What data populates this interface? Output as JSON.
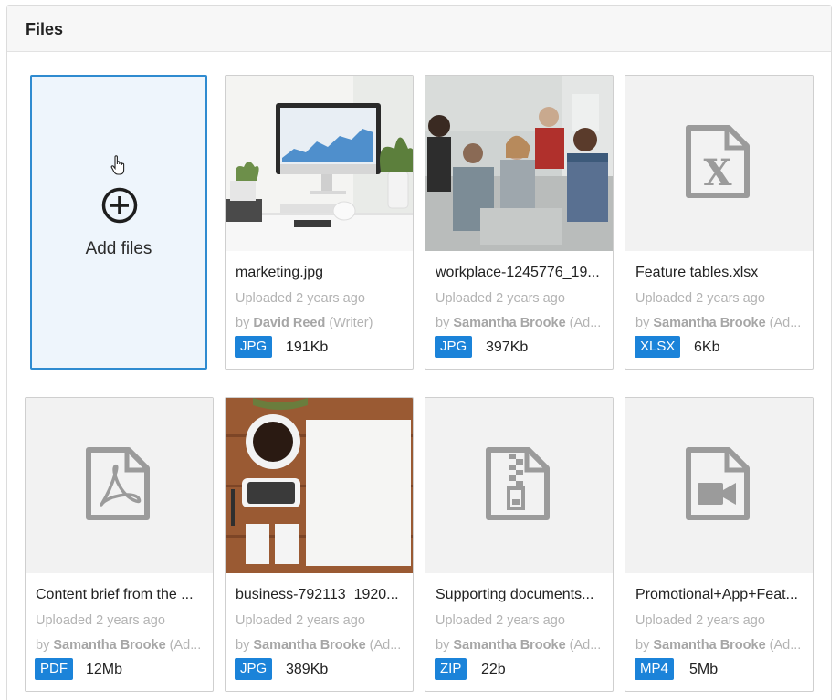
{
  "panel": {
    "title": "Files"
  },
  "add_files": {
    "label": "Add files"
  },
  "files": [
    {
      "name": "marketing.jpg",
      "uploaded": "Uploaded 2 years ago",
      "by": "by",
      "author": "David Reed",
      "role": " (Writer)",
      "type": "JPG",
      "size": "191Kb"
    },
    {
      "name": "workplace-1245776_19...",
      "uploaded": "Uploaded 2 years ago",
      "by": "by",
      "author": "Samantha Brooke",
      "role": " (Ad...",
      "type": "JPG",
      "size": "397Kb"
    },
    {
      "name": "Feature tables.xlsx",
      "uploaded": "Uploaded 2 years ago",
      "by": "by",
      "author": "Samantha Brooke",
      "role": " (Ad...",
      "type": "XLSX",
      "size": "6Kb",
      "icon": "excel-file-icon"
    },
    {
      "name": "Content brief from the ...",
      "uploaded": "Uploaded 2 years ago",
      "by": "by",
      "author": "Samantha Brooke",
      "role": " (Ad...",
      "type": "PDF",
      "size": "12Mb",
      "icon": "pdf-file-icon"
    },
    {
      "name": "business-792113_1920...",
      "uploaded": "Uploaded 2 years ago",
      "by": "by",
      "author": "Samantha Brooke",
      "role": " (Ad...",
      "type": "JPG",
      "size": "389Kb"
    },
    {
      "name": "Supporting documents...",
      "uploaded": "Uploaded 2 years ago",
      "by": "by",
      "author": "Samantha Brooke",
      "role": " (Ad...",
      "type": "ZIP",
      "size": "22b",
      "icon": "zip-file-icon"
    },
    {
      "name": "Promotional+App+Feat...",
      "uploaded": "Uploaded 2 years ago",
      "by": "by",
      "author": "Samantha Brooke",
      "role": " (Ad...",
      "type": "MP4",
      "size": "5Mb",
      "icon": "video-file-icon"
    }
  ],
  "colors": {
    "badge": "#1b83d9",
    "accent_border": "#2f8bd0",
    "add_bg": "#eef5fc"
  }
}
